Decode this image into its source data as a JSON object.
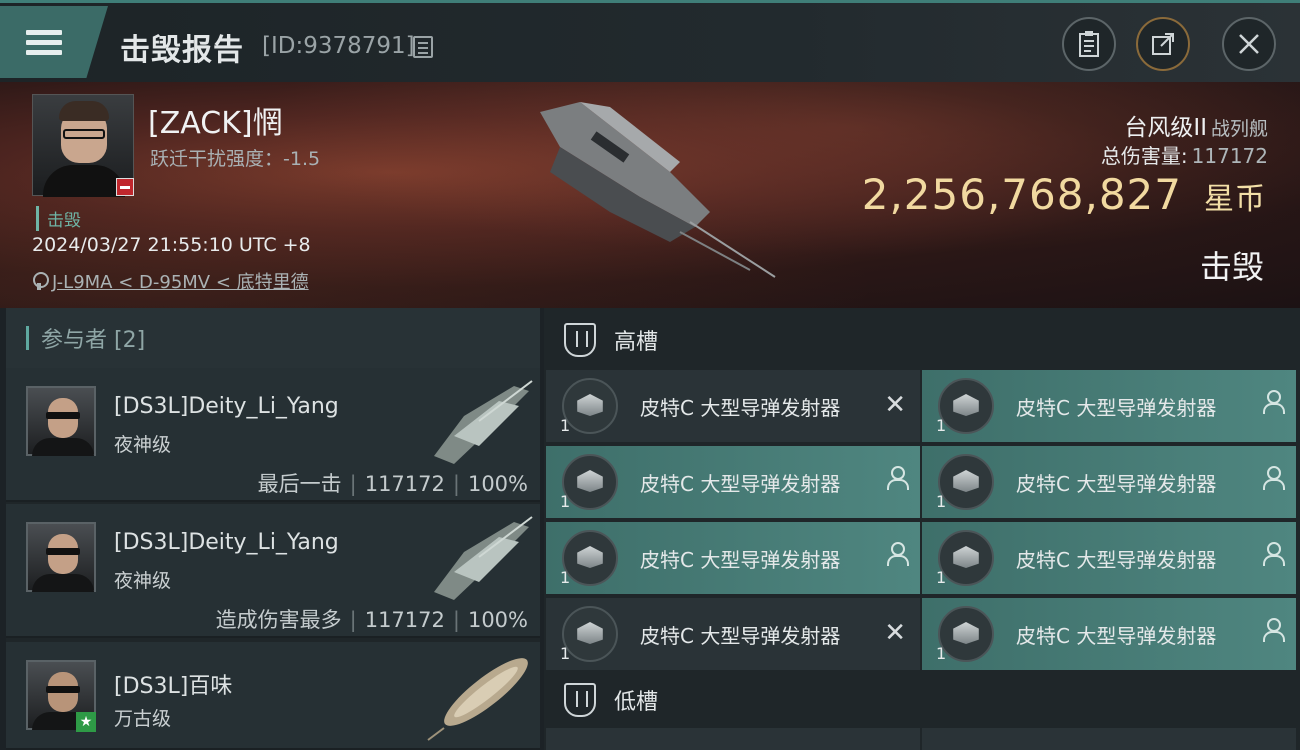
{
  "header": {
    "title": "击毁报告",
    "id_text": "[ID:9378791]"
  },
  "victim": {
    "name": "[ZACK]惘",
    "warp_strength": "跃迁干扰强度：-1.5",
    "tag": "击毁",
    "datetime": "2024/03/27 21:55:10 UTC +8",
    "location": "J-L9MA < D-95MV < 底特里德",
    "ship_name": "台风级II",
    "ship_type": "战列舰",
    "total_damage_label": "总伤害量:",
    "total_damage": "117172",
    "isk_value": "2,256,768,827",
    "isk_unit": "星币",
    "result": "击毁"
  },
  "participants": {
    "header": "参与者 [2]",
    "items": [
      {
        "name": "[DS3L]Deity_Li_Yang",
        "ship": "夜神级",
        "role": "最后一击",
        "damage": "117172",
        "percent": "100%"
      },
      {
        "name": "[DS3L]Deity_Li_Yang",
        "ship": "夜神级",
        "role": "造成伤害最多",
        "damage": "117172",
        "percent": "100%"
      },
      {
        "name": "[DS3L]百味",
        "ship": "万古级"
      }
    ]
  },
  "fitting": {
    "high_label": "高槽",
    "low_label": "低槽",
    "modules": [
      {
        "name": "皮特C 大型导弹发射器",
        "qty": "1",
        "status": "destroyed"
      },
      {
        "name": "皮特C 大型导弹发射器",
        "qty": "1",
        "status": "dropped"
      },
      {
        "name": "皮特C 大型导弹发射器",
        "qty": "1",
        "status": "dropped"
      },
      {
        "name": "皮特C 大型导弹发射器",
        "qty": "1",
        "status": "dropped"
      },
      {
        "name": "皮特C 大型导弹发射器",
        "qty": "1",
        "status": "dropped"
      },
      {
        "name": "皮特C 大型导弹发射器",
        "qty": "1",
        "status": "dropped"
      },
      {
        "name": "皮特C 大型导弹发射器",
        "qty": "1",
        "status": "destroyed"
      },
      {
        "name": "皮特C 大型导弹发射器",
        "qty": "1",
        "status": "dropped"
      }
    ]
  },
  "colors": {
    "accent": "#4f8680",
    "isk": "#f1d9a0",
    "hero_bg": "#4e2520"
  }
}
